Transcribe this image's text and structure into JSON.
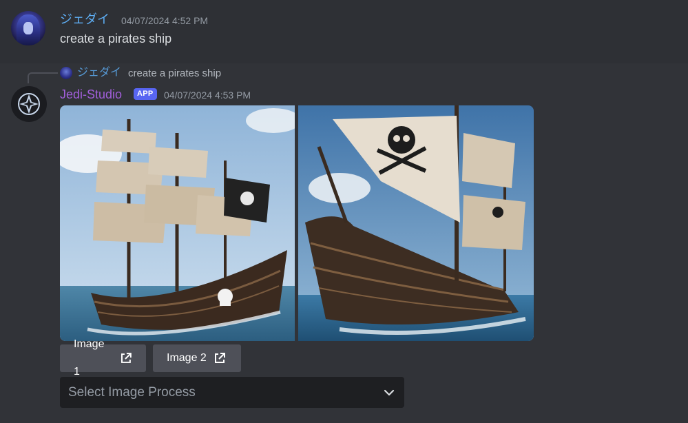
{
  "messages": [
    {
      "author": "ジェダイ",
      "timestamp": "04/07/2024 4:52 PM",
      "text": "create a pirates ship",
      "author_color": "#5eaef4"
    },
    {
      "reply_to": {
        "author": "ジェダイ",
        "text": "create a pirates ship"
      },
      "author": "Jedi-Studio",
      "badge": "APP",
      "timestamp": "04/07/2024 4:53 PM",
      "author_color": "#a25fdb",
      "images": [
        {
          "subject": "pirate ship with skull flag, three masts"
        },
        {
          "subject": "pirate ship close-up with large skull sail"
        }
      ],
      "buttons": [
        {
          "label": "Image 1",
          "icon": "external-link-icon"
        },
        {
          "label": "Image 2",
          "icon": "external-link-icon"
        }
      ],
      "select": {
        "placeholder": "Select Image Process",
        "icon": "chevron-down-icon"
      }
    }
  ],
  "colors": {
    "background": "#313338",
    "button": "#4e5058",
    "badge": "#5865f2",
    "select_bg": "#1e1f22"
  }
}
